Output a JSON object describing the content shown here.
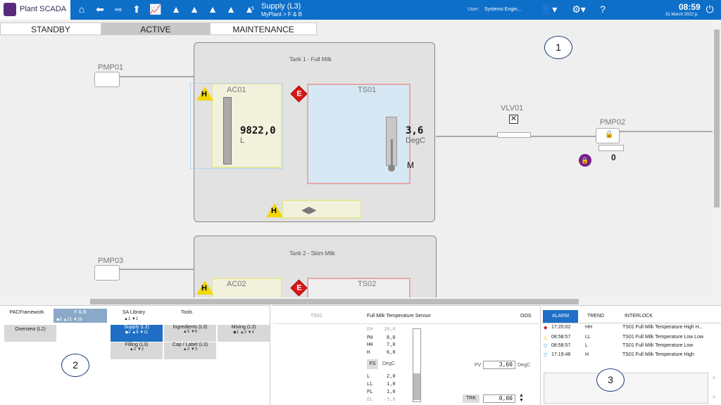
{
  "app": {
    "name": "Plant SCADA",
    "title": "Supply (L3)",
    "path": "MyPlant > F & B",
    "user_label": "User:",
    "user": "Systems Engin...",
    "time": "08:59",
    "date": "31 March 2022 р.",
    "alarm_count": "5"
  },
  "modes": [
    "STANDBY",
    "ACTIVE",
    "MAINTENANCE"
  ],
  "active_mode": "ACTIVE",
  "canvas": {
    "tank1_title": "Tank 1 - Full Milk",
    "tank2_title": "Tank 2 - Skim Milk",
    "pmp01": "PMP01",
    "pmp02": "PMP02",
    "pmp03": "PMP03",
    "vlv01": "VLV01",
    "ac01": "AC01",
    "ac01_value": "9822,0",
    "ac01_unit": "L",
    "ts01": "TS01",
    "ts01_value": "3,6",
    "ts01_unit": "DegC",
    "ts01_mode": "M",
    "ac02": "AC02",
    "ts02": "TS02",
    "pmp02_value": "0",
    "badge_h": "H",
    "badge_e": "E"
  },
  "callouts": [
    "1",
    "2",
    "3"
  ],
  "nav": {
    "pac": "PACFramework",
    "fb": "F & B",
    "fb_counts": [
      "3",
      "21",
      "26"
    ],
    "sa": "SA Library",
    "sa_counts": [
      "1",
      "1"
    ],
    "tools": "Tools",
    "overview": "Overview (L2)",
    "supply": "Supply (L3)",
    "supply_counts": [
      "2",
      "8",
      "11"
    ],
    "ingredients": "Ingredients (L3)",
    "ingredients_counts": [
      "5",
      "6"
    ],
    "mixing": "Mixing (L3)",
    "mixing_counts": [
      "1",
      "3",
      "4"
    ],
    "filling": "Filling (L3)",
    "filling_counts": [
      "2",
      "2"
    ],
    "cap": "Cap / Label (L3)",
    "cap_counts": [
      "3",
      "3"
    ]
  },
  "detail": {
    "tag": "TS01",
    "desc": "Full Milk Temperature Sensor",
    "mode": "OOS",
    "fs": "FS",
    "fs_unit": "DegC",
    "limits_high": [
      {
        "l": "EH",
        "v": "10,0"
      },
      {
        "l": "PH",
        "v": "8,0"
      },
      {
        "l": "HH",
        "v": "7,0"
      },
      {
        "l": "H",
        "v": "6,0"
      }
    ],
    "limits_low": [
      {
        "l": "L",
        "v": "2,0"
      },
      {
        "l": "LL",
        "v": "1,0"
      },
      {
        "l": "PL",
        "v": "1,0"
      },
      {
        "l": "EL",
        "v": "-5,0"
      }
    ],
    "pv_label": "PV",
    "pv": "3,60",
    "pv_unit": "DegC",
    "trk_label": "TRK",
    "trk": "0,00"
  },
  "alarms_panel": {
    "tabs": [
      "ALARM",
      "TREND",
      "INTERLOCK"
    ],
    "rows": [
      {
        "time": "17:20:02",
        "level": "HH",
        "text": "TS01 Full Milk Temperature High H...",
        "color": "#d81818"
      },
      {
        "time": "08:58:57",
        "level": "LL",
        "text": "TS01 Full Milk Temperature Low Low",
        "color": "#e0b000"
      },
      {
        "time": "08:58:57",
        "level": "L",
        "text": "TS01 Full Milk Temperature Low",
        "color": "#2a8fd0"
      },
      {
        "time": "17:19:48",
        "level": "H",
        "text": "TS01 Full Milk Temperature High",
        "color": "#2a8fd0"
      }
    ]
  },
  "colors": {
    "topbar": "#0e6fc9",
    "selected": "#1f6fc6",
    "alarm_red": "#d81818",
    "warn_yellow": "#f2d800"
  }
}
